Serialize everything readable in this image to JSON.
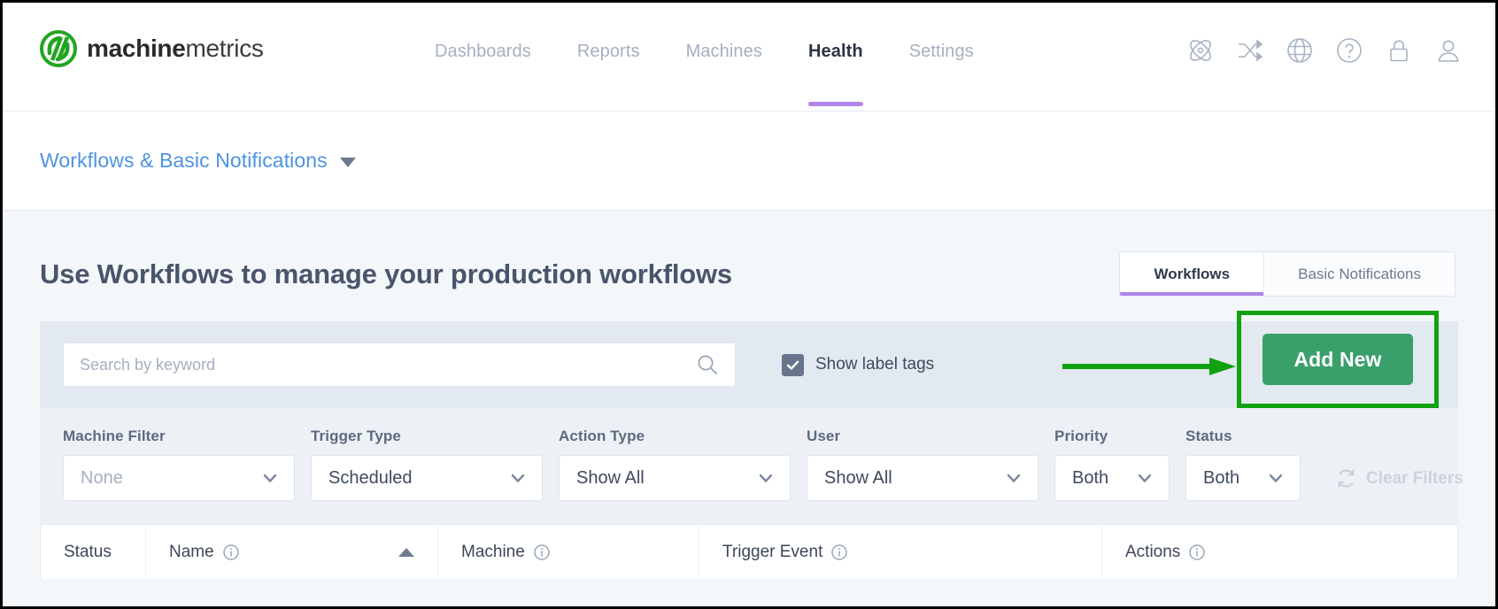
{
  "brand": {
    "name_bold": "machine",
    "name_light": "metrics",
    "logo_icon": "machinemetrics-logo-icon",
    "logo_color": "#22a522"
  },
  "topnav": {
    "items": [
      {
        "label": "Dashboards",
        "active": false
      },
      {
        "label": "Reports",
        "active": false
      },
      {
        "label": "Machines",
        "active": false
      },
      {
        "label": "Health",
        "active": true
      },
      {
        "label": "Settings",
        "active": false
      }
    ],
    "active_underline_color": "#b085ea",
    "icons": [
      {
        "name": "atom-icon"
      },
      {
        "name": "shuffle-icon"
      },
      {
        "name": "globe-icon"
      },
      {
        "name": "help-circle-icon"
      },
      {
        "name": "lock-icon"
      },
      {
        "name": "user-icon"
      }
    ]
  },
  "breadcrumb": {
    "label": "Workflows & Basic Notifications",
    "caret_icon": "chevron-down-icon",
    "link_color": "#4d94e0"
  },
  "main": {
    "title": "Use Workflows to manage your production workflows",
    "tabs": [
      {
        "label": "Workflows",
        "active": true
      },
      {
        "label": "Basic Notifications",
        "active": false
      }
    ]
  },
  "toolbar": {
    "search_placeholder": "Search by keyword",
    "search_value": "",
    "search_icon": "search-icon",
    "show_label_tags": "Show label tags",
    "show_label_tags_checked": true,
    "add_new_label": "Add New",
    "add_new_color": "#3aa06b"
  },
  "annotation": {
    "color": "#11a111",
    "arrow": "green-arrow-pointing-right",
    "highlight_target": "Add New"
  },
  "filters": [
    {
      "label": "Machine Filter",
      "value": "None",
      "placeholder": true,
      "width_class": "w-machine"
    },
    {
      "label": "Trigger Type",
      "value": "Scheduled",
      "placeholder": false,
      "width_class": "w-trigger"
    },
    {
      "label": "Action Type",
      "value": "Show All",
      "placeholder": false,
      "width_class": "w-action"
    },
    {
      "label": "User",
      "value": "Show All",
      "placeholder": false,
      "width_class": "w-user"
    },
    {
      "label": "Priority",
      "value": "Both",
      "placeholder": false,
      "width_class": "w-prio"
    },
    {
      "label": "Status",
      "value": "Both",
      "placeholder": false,
      "width_class": "w-status"
    }
  ],
  "clear_filters": {
    "label": "Clear Filters",
    "icon": "refresh-icon",
    "disabled": true
  },
  "table": {
    "columns": [
      {
        "label": "Status",
        "info": false,
        "sort": null,
        "class": "th-status"
      },
      {
        "label": "Name",
        "info": true,
        "sort": "asc",
        "class": "th-name"
      },
      {
        "label": "Machine",
        "info": true,
        "sort": null,
        "class": "th-machine"
      },
      {
        "label": "Trigger Event",
        "info": true,
        "sort": null,
        "class": "th-trigger"
      },
      {
        "label": "Actions",
        "info": true,
        "sort": null,
        "class": "th-actions"
      }
    ]
  }
}
